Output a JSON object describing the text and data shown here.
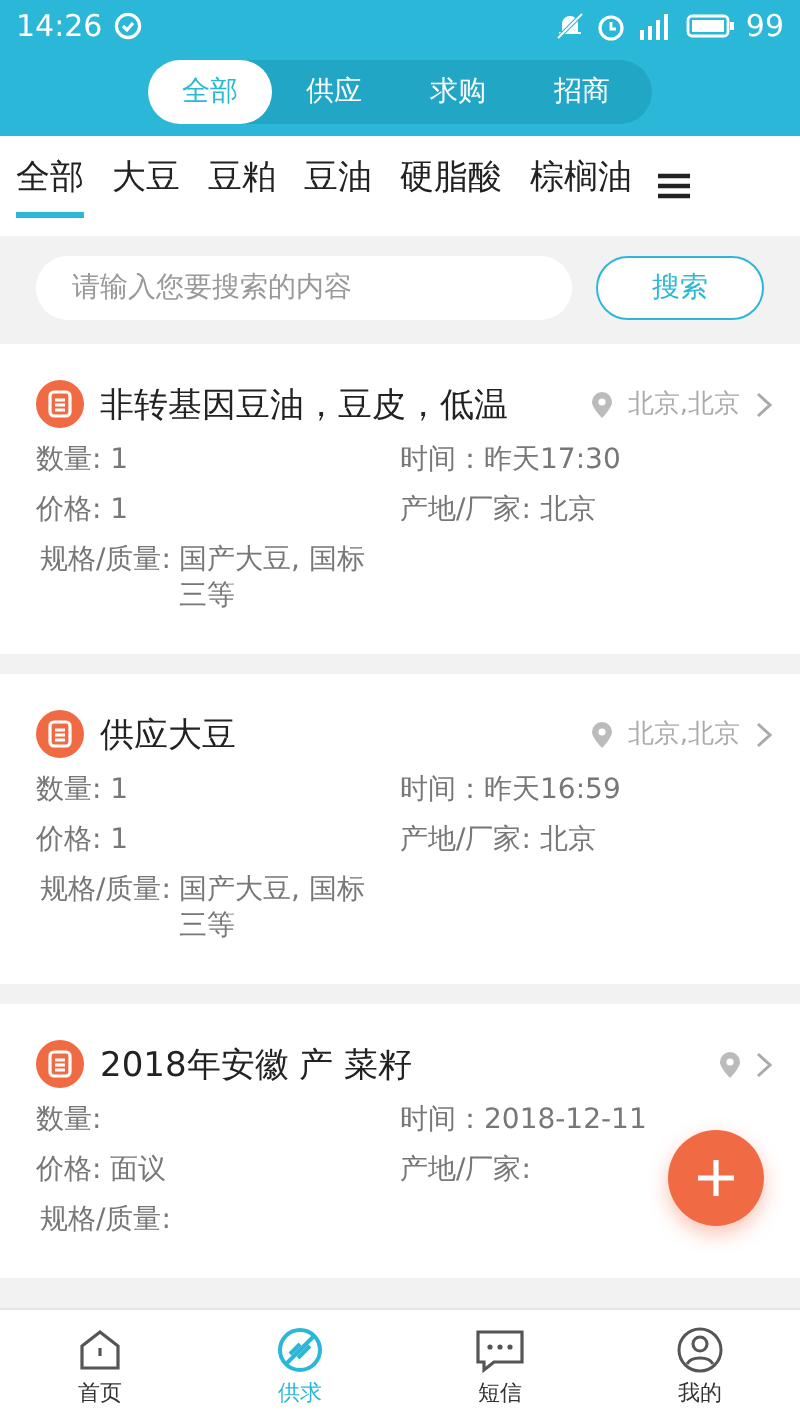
{
  "status_bar": {
    "time": "14:26",
    "battery": "99"
  },
  "segments": [
    {
      "label": "全部",
      "selected": true
    },
    {
      "label": "供应",
      "selected": false
    },
    {
      "label": "求购",
      "selected": false
    },
    {
      "label": "招商",
      "selected": false
    }
  ],
  "categories": [
    {
      "label": "全部",
      "selected": true
    },
    {
      "label": "大豆",
      "selected": false
    },
    {
      "label": "豆粕",
      "selected": false
    },
    {
      "label": "豆油",
      "selected": false
    },
    {
      "label": "硬脂酸",
      "selected": false
    },
    {
      "label": "棕榈油",
      "selected": false
    }
  ],
  "search": {
    "placeholder": "请输入您要搜索的内容",
    "button": "搜索"
  },
  "cards": [
    {
      "title": "非转基因豆油，豆皮，低温",
      "location": "北京,北京",
      "quantity": "数量: 1",
      "time": "时间：昨天17:30",
      "price": "价格: 1",
      "origin": "产地/厂家: 北京",
      "spec_label": "规格/质量:",
      "spec_value": "国产大豆, 国标三等"
    },
    {
      "title": "供应大豆",
      "location": "北京,北京",
      "quantity": "数量: 1",
      "time": "时间：昨天16:59",
      "price": "价格: 1",
      "origin": "产地/厂家: 北京",
      "spec_label": "规格/质量:",
      "spec_value": "国产大豆, 国标三等"
    },
    {
      "title": "2018年安徽 产 菜籽",
      "quantity": "数量:",
      "time": "时间：2018-12-11",
      "price": "价格: 面议",
      "origin": "产地/厂家:",
      "spec_label": "规格/质量:"
    }
  ],
  "bottom_nav": [
    {
      "label": "首页",
      "kind": "home",
      "selected": false
    },
    {
      "label": "供求",
      "kind": "trade",
      "selected": true
    },
    {
      "label": "短信",
      "kind": "message",
      "selected": false
    },
    {
      "label": "我的",
      "kind": "profile",
      "selected": false
    }
  ]
}
